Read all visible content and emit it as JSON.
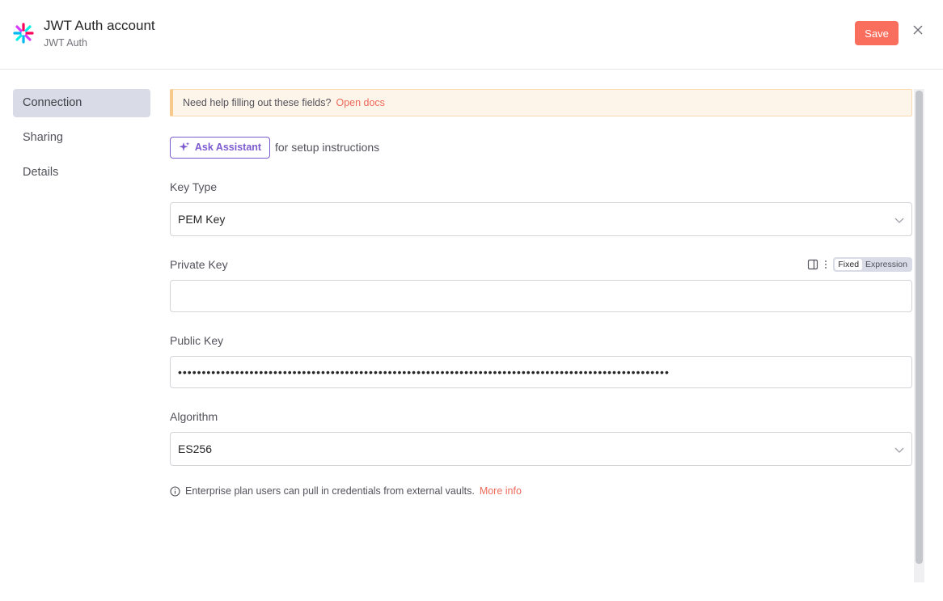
{
  "header": {
    "title": "JWT Auth account",
    "subtitle": "JWT Auth",
    "save_label": "Save",
    "logo_icon": "jwt-logo-icon",
    "close_icon": "close-icon"
  },
  "sidebar": {
    "items": [
      {
        "label": "Connection",
        "active": true
      },
      {
        "label": "Sharing",
        "active": false
      },
      {
        "label": "Details",
        "active": false
      }
    ]
  },
  "main": {
    "banner": {
      "text": "Need help filling out these fields?",
      "link": "Open docs"
    },
    "assistant": {
      "button_label": "Ask Assistant",
      "suffix": "for setup instructions",
      "icon": "sparkle-icon"
    },
    "key_type": {
      "label": "Key Type",
      "value": "PEM Key"
    },
    "private_key": {
      "label": "Private Key",
      "value": "",
      "toggle_fixed": "Fixed",
      "toggle_expression": "Expression"
    },
    "public_key": {
      "label": "Public Key",
      "value": "•••••••••••••••••••••••••••••••••••••••••••••••••••••••••••••••••••••••••••••••••••••••••••••••••••••••"
    },
    "algorithm": {
      "label": "Algorithm",
      "value": "ES256"
    },
    "info": {
      "text": "Enterprise plan users can pull in credentials from external vaults.",
      "link": "More info"
    }
  },
  "colors": {
    "accent": "#fa6e5e",
    "assistant": "#7c5bd1",
    "banner_bg": "#fef5ea",
    "active_nav": "#d9dce6"
  }
}
